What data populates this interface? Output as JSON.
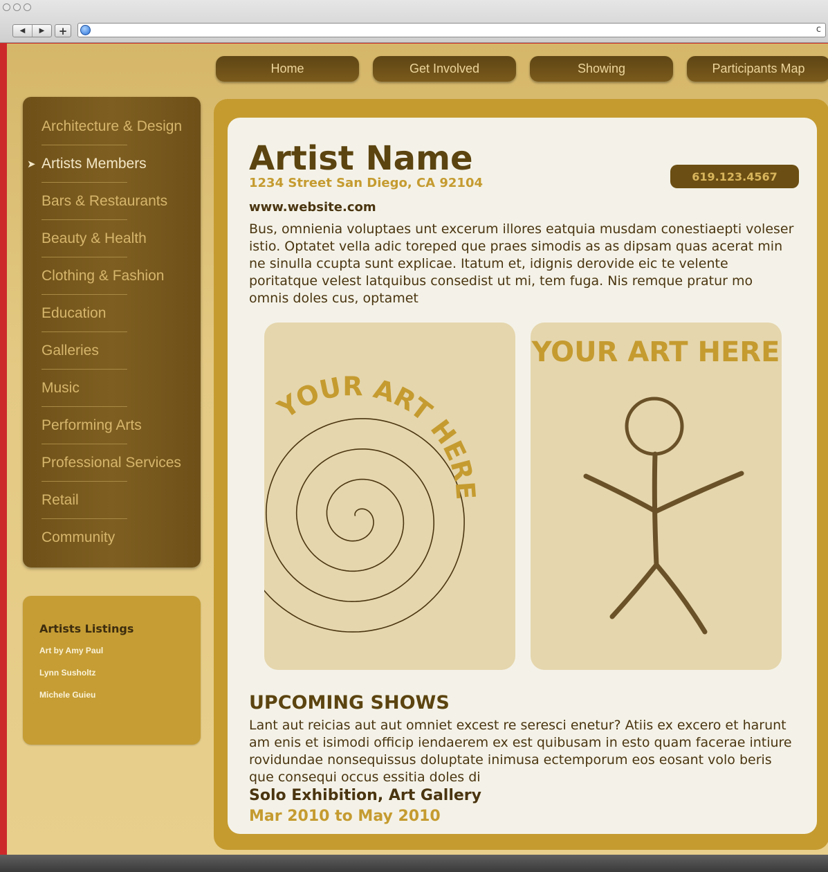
{
  "browser": {
    "back_glyph": "◀",
    "forward_glyph": "▶",
    "plus_glyph": "+",
    "reload_glyph": "c",
    "url": ""
  },
  "topnav": [
    "Home",
    "Get Involved",
    "Showing",
    "Participants Map"
  ],
  "sidebar": {
    "items": [
      {
        "label": "Architecture & Design",
        "active": false
      },
      {
        "label": "Artists Members",
        "active": true
      },
      {
        "label": "Bars & Restaurants",
        "active": false
      },
      {
        "label": "Beauty & Health",
        "active": false
      },
      {
        "label": "Clothing & Fashion",
        "active": false
      },
      {
        "label": "Education",
        "active": false
      },
      {
        "label": "Galleries",
        "active": false
      },
      {
        "label": "Music",
        "active": false
      },
      {
        "label": "Performing Arts",
        "active": false
      },
      {
        "label": "Professional Services",
        "active": false
      },
      {
        "label": "Retail",
        "active": false
      },
      {
        "label": "Community",
        "active": false
      }
    ],
    "active_marker": "➤"
  },
  "listings": {
    "title": "Artists Listings",
    "items": [
      "Art by Amy Paul",
      "Lynn Susholtz",
      "Michele Guieu"
    ]
  },
  "artist": {
    "name": "Artist Name",
    "address": "1234 Street San Diego, CA 92104",
    "phone": "619.123.4567",
    "website": "www.website.com",
    "bio": "Bus, omnienia voluptaes unt excerum illores eatquia musdam conestiaepti voleser istio. Optatet vella adic toreped que praes simodis as as dipsam quas acerat min ne sinulla ccupta sunt explicae. Itatum et, idignis derovide eic te velente poritatque velest latquibus consedist ut mi, tem fuga. Nis remque pratur mo omnis doles cus, optamet"
  },
  "art": {
    "panel1_text": "YOUR ART HERE",
    "panel2_text": "YOUR ART HERE"
  },
  "shows": {
    "title": "UPCOMING SHOWS",
    "text": "Lant aut reicias aut aut omniet excest re seresci enetur? Atiis ex excero et harunt am enis et isimodi officip iendaerem ex est quibusam in esto quam facerae intiure rovidundae nonsequissus doluptate inimusa ectemporum eos eosant volo beris que consequi occus essitia doles di",
    "show_name": "Solo Exhibition, Art Gallery",
    "show_dates": "Mar 2010 to May 2010"
  },
  "colors": {
    "accent_gold": "#c59b30",
    "dark_brown": "#5c4410",
    "card_bg": "#f4f2e8",
    "art_bg": "#e5d6ad"
  }
}
